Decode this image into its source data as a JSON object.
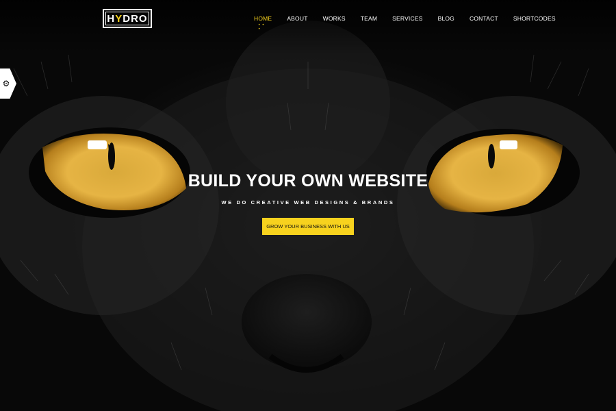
{
  "header": {
    "logo": {
      "prefix": "H",
      "accent": "Y",
      "suffix": "DRO"
    },
    "nav": [
      {
        "label": "HOME",
        "active": true
      },
      {
        "label": "ABOUT"
      },
      {
        "label": "WORKS"
      },
      {
        "label": "TEAM"
      },
      {
        "label": "SERVICES"
      },
      {
        "label": "BLOG"
      },
      {
        "label": "CONTACT"
      },
      {
        "label": "SHORTCODES"
      }
    ]
  },
  "settings_panel": {
    "icon": "gear-icon"
  },
  "hero": {
    "headline": "BUILD YOUR OWN WEBSITE",
    "subline": "WE DO CREATIVE WEB DESIGNS & BRANDS",
    "cta_label": "GROW YOUR BUSINESS WITH US",
    "background_image": "black-cat-face-with-yellow-eyes"
  },
  "colors": {
    "accent": "#f7d21e",
    "background": "#0a0a0a",
    "text": "#ffffff"
  }
}
